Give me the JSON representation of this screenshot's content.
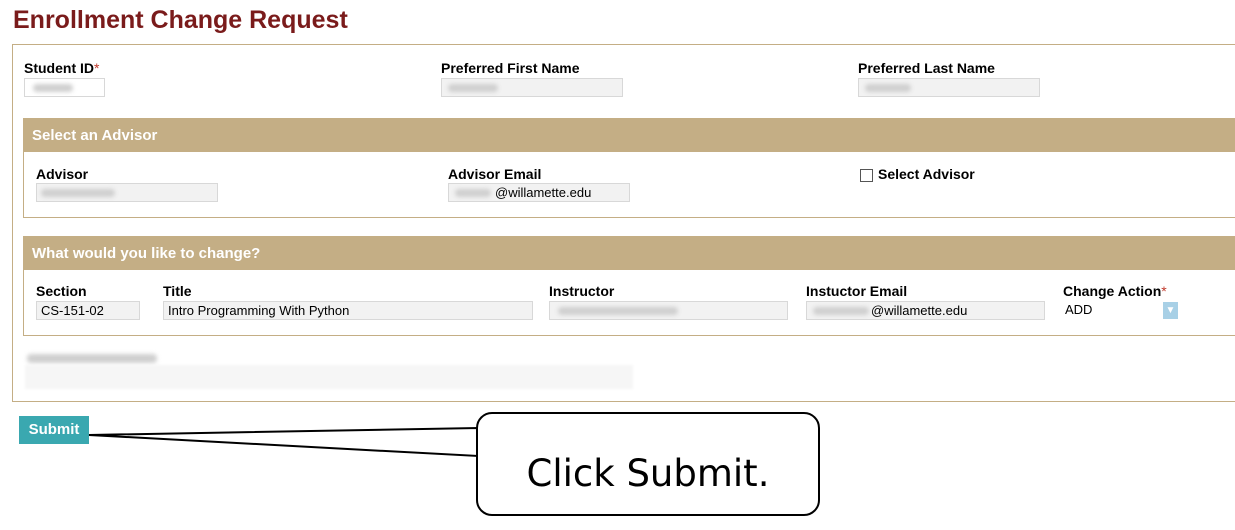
{
  "page": {
    "title": "Enrollment Change Request"
  },
  "student": {
    "id_label": "Student ID",
    "required_mark": "*",
    "first_name_label": "Preferred First Name",
    "last_name_label": "Preferred Last Name"
  },
  "advisor_section": {
    "header": "Select an Advisor",
    "advisor_label": "Advisor",
    "email_label": "Advisor Email",
    "email_value": "@willamette.edu",
    "select_label": "Select Advisor"
  },
  "change_section": {
    "header": "What would you like to change?",
    "section_label": "Section",
    "section_value": "CS-151-02",
    "title_label": "Title",
    "title_value": "Intro Programming With Python",
    "instructor_label": "Instructor",
    "instructor_email_label": "Instuctor Email",
    "instructor_email_value": "@willamette.edu",
    "action_label": "Change Action",
    "required_mark": "*",
    "action_value": "ADD"
  },
  "submit_label": "Submit",
  "callout": {
    "text": "Click Submit."
  },
  "colors": {
    "title": "#7a1b1b",
    "section_header": "#c4ae85",
    "submit_button": "#3aa8b0",
    "required": "#c0392b"
  }
}
